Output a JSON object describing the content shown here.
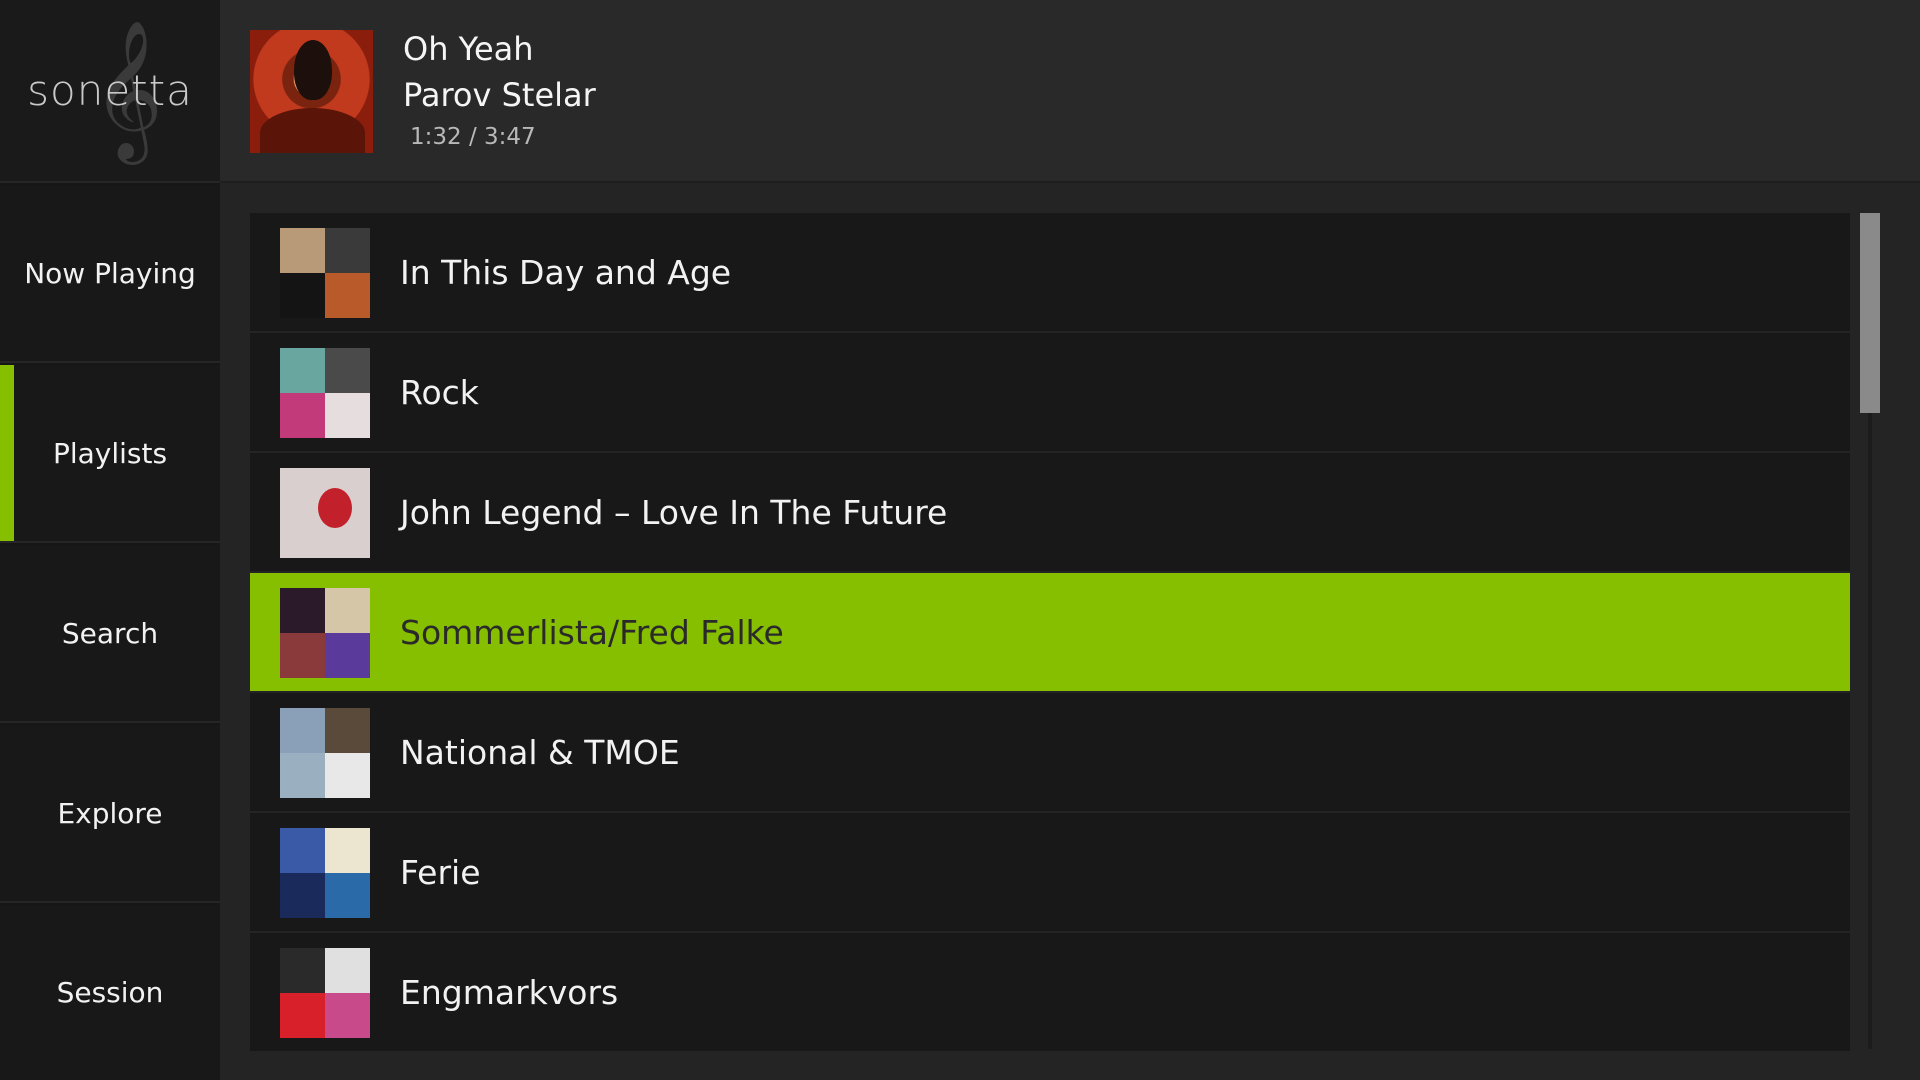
{
  "app": {
    "logo_text": "sonetta",
    "accent_color": "#86be00"
  },
  "sidebar": {
    "items": [
      {
        "label": "Now Playing",
        "active": false
      },
      {
        "label": "Playlists",
        "active": true
      },
      {
        "label": "Search",
        "active": false
      },
      {
        "label": "Explore",
        "active": false
      },
      {
        "label": "Session",
        "active": false
      }
    ]
  },
  "now_playing": {
    "title": "Oh Yeah",
    "artist": "Parov Stelar",
    "time": "1:32 /  3:47",
    "cover_icon": "album-cover"
  },
  "playlists": [
    {
      "name": "In This Day and Age",
      "colors": [
        "#b89a78",
        "#3a3a3a",
        "#141414",
        "#b85a2a"
      ],
      "selected": false
    },
    {
      "name": "Rock",
      "colors": [
        "#6aa6a0",
        "#4a4a4a",
        "#c23a7a",
        "#e6dede"
      ],
      "selected": false
    },
    {
      "name": "John Legend – Love In The Future",
      "colors": [
        "#d9cfcf"
      ],
      "selected": false
    },
    {
      "name": "Sommerlista/Fred Falke",
      "colors": [
        "#2a1a2a",
        "#d6c6a8",
        "#8a3a3a",
        "#5a3a9a"
      ],
      "selected": true
    },
    {
      "name": "National & TMOE",
      "colors": [
        "#8aa0b8",
        "#5a4a3a",
        "#9ab0c0",
        "#e8e8e8"
      ],
      "selected": false
    },
    {
      "name": "Ferie",
      "colors": [
        "#3a5aa8",
        "#ece6d0",
        "#1a2a5a",
        "#2a6aa8"
      ],
      "selected": false
    },
    {
      "name": "Engmarkvors",
      "colors": [
        "#2a2a2a",
        "#e0e0e0",
        "#d8202a",
        "#c84a8a"
      ],
      "selected": false
    }
  ]
}
